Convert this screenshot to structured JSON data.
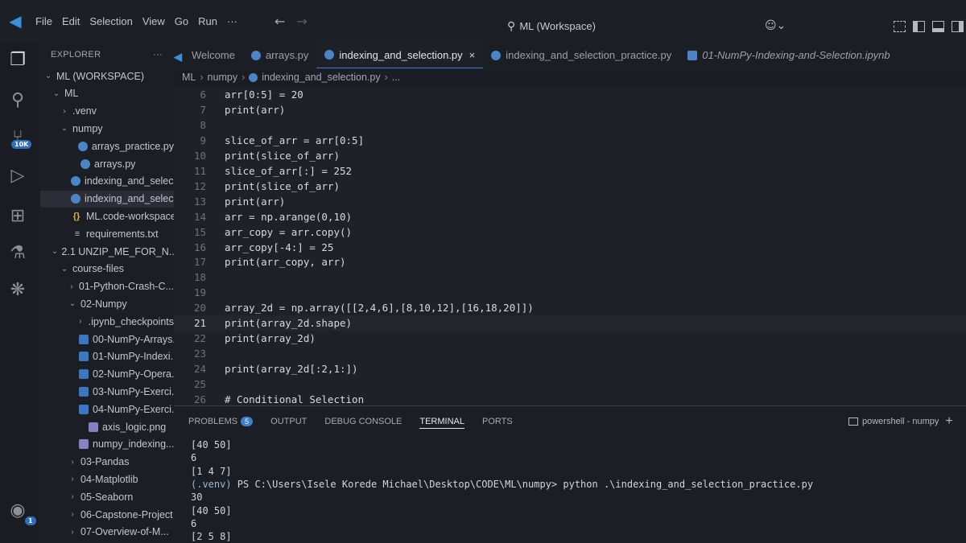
{
  "titlebar": {
    "menu": [
      "File",
      "Edit",
      "Selection",
      "View",
      "Go",
      "Run",
      "···"
    ],
    "search_title": "ML (Workspace)"
  },
  "activitybar": {
    "source_control_badge": "10K",
    "account_badge": "1"
  },
  "sidebar": {
    "title": "EXPLORER",
    "more": "···",
    "tree": [
      {
        "label": "ML (WORKSPACE)",
        "indent": 0,
        "chev": "v",
        "icon": "none"
      },
      {
        "label": "ML",
        "indent": 1,
        "chev": "v",
        "icon": "none"
      },
      {
        "label": ".venv",
        "indent": 2,
        "chev": ">",
        "icon": "none"
      },
      {
        "label": "numpy",
        "indent": 2,
        "chev": "v",
        "icon": "none"
      },
      {
        "label": "arrays_practice.py",
        "indent": 3,
        "chev": "",
        "icon": "py"
      },
      {
        "label": "arrays.py",
        "indent": 3,
        "chev": "",
        "icon": "py"
      },
      {
        "label": "indexing_and_selec...",
        "indent": 3,
        "chev": "",
        "icon": "py"
      },
      {
        "label": "indexing_and_selec...",
        "indent": 3,
        "chev": "",
        "icon": "py",
        "selected": true
      },
      {
        "label": "ML.code-workspace",
        "indent": 3,
        "chev": "",
        "icon": "cfg"
      },
      {
        "label": "requirements.txt",
        "indent": 2,
        "chev": "",
        "icon": "txt"
      },
      {
        "label": "2.1 UNZIP_ME_FOR_N...",
        "indent": 1,
        "chev": "v",
        "icon": "none"
      },
      {
        "label": "course-files",
        "indent": 2,
        "chev": "v",
        "icon": "none"
      },
      {
        "label": "01-Python-Crash-C...",
        "indent": 3,
        "chev": ">",
        "icon": "none"
      },
      {
        "label": "02-Numpy",
        "indent": 3,
        "chev": "v",
        "icon": "none"
      },
      {
        "label": ".ipynb_checkpoints",
        "indent": 4,
        "chev": ">",
        "icon": "none"
      },
      {
        "label": "00-NumPy-Arrays...",
        "indent": 4,
        "chev": "",
        "icon": "nb"
      },
      {
        "label": "01-NumPy-Indexi...",
        "indent": 4,
        "chev": "",
        "icon": "nb"
      },
      {
        "label": "02-NumPy-Opera...",
        "indent": 4,
        "chev": "",
        "icon": "nb"
      },
      {
        "label": "03-NumPy-Exerci...",
        "indent": 4,
        "chev": "",
        "icon": "nb"
      },
      {
        "label": "04-NumPy-Exerci...",
        "indent": 4,
        "chev": "",
        "icon": "nb"
      },
      {
        "label": "axis_logic.png",
        "indent": 4,
        "chev": "",
        "icon": "img"
      },
      {
        "label": "numpy_indexing....",
        "indent": 4,
        "chev": "",
        "icon": "img"
      },
      {
        "label": "03-Pandas",
        "indent": 3,
        "chev": ">",
        "icon": "none"
      },
      {
        "label": "04-Matplotlib",
        "indent": 3,
        "chev": ">",
        "icon": "none"
      },
      {
        "label": "05-Seaborn",
        "indent": 3,
        "chev": ">",
        "icon": "none"
      },
      {
        "label": "06-Capstone-Project",
        "indent": 3,
        "chev": ">",
        "icon": "none"
      },
      {
        "label": "07-Overview-of-M...",
        "indent": 3,
        "chev": ">",
        "icon": "none"
      }
    ]
  },
  "tabs": [
    {
      "label": "Welcome",
      "icon": "vsc",
      "active": false,
      "italic": false
    },
    {
      "label": "arrays.py",
      "icon": "py",
      "active": false,
      "italic": false
    },
    {
      "label": "indexing_and_selection.py",
      "icon": "py",
      "active": true,
      "italic": false,
      "close": "×"
    },
    {
      "label": "indexing_and_selection_practice.py",
      "icon": "py",
      "active": false,
      "italic": false
    },
    {
      "label": "01-NumPy-Indexing-and-Selection.ipynb",
      "icon": "nb",
      "active": false,
      "italic": true
    }
  ],
  "breadcrumb": [
    "ML",
    "numpy",
    "indexing_and_selection.py",
    "..."
  ],
  "editor": {
    "current_line": "21",
    "lines": [
      {
        "n": "6",
        "code": "arr[0:5] = 20"
      },
      {
        "n": "7",
        "code": "print(arr)"
      },
      {
        "n": "8",
        "code": ""
      },
      {
        "n": "9",
        "code": "slice_of_arr = arr[0:5]"
      },
      {
        "n": "10",
        "code": "print(slice_of_arr)"
      },
      {
        "n": "11",
        "code": "slice_of_arr[:] = 252"
      },
      {
        "n": "12",
        "code": "print(slice_of_arr)"
      },
      {
        "n": "13",
        "code": "print(arr)"
      },
      {
        "n": "14",
        "code": "arr = np.arange(0,10)"
      },
      {
        "n": "15",
        "code": "arr_copy = arr.copy()"
      },
      {
        "n": "16",
        "code": "arr_copy[-4:] = 25"
      },
      {
        "n": "17",
        "code": "print(arr_copy, arr)"
      },
      {
        "n": "18",
        "code": ""
      },
      {
        "n": "19",
        "code": ""
      },
      {
        "n": "20",
        "code": "array_2d = np.array([[2,4,6],[8,10,12],[16,18,20]])"
      },
      {
        "n": "21",
        "code": "print(array_2d.shape)"
      },
      {
        "n": "22",
        "code": "print(array_2d)"
      },
      {
        "n": "23",
        "code": ""
      },
      {
        "n": "24",
        "code": "print(array_2d[:2,1:])"
      },
      {
        "n": "25",
        "code": ""
      },
      {
        "n": "26",
        "code": "# Conditional Selection"
      }
    ]
  },
  "panel": {
    "tabs": [
      "PROBLEMS",
      "OUTPUT",
      "DEBUG CONSOLE",
      "TERMINAL",
      "PORTS"
    ],
    "active_tab": "TERMINAL",
    "problems_count": "5",
    "terminal_name": "powershell - numpy",
    "add": "+",
    "output": [
      {
        "venv": "",
        "text": "[40 50]"
      },
      {
        "venv": "",
        "text": "6"
      },
      {
        "venv": "",
        "text": "[1 4 7]"
      },
      {
        "venv": "(.venv)",
        "text": " PS C:\\Users\\Isele Korede Michael\\Desktop\\CODE\\ML\\numpy> python .\\indexing_and_selection_practice.py"
      },
      {
        "venv": "",
        "text": "30"
      },
      {
        "venv": "",
        "text": "[40 50]"
      },
      {
        "venv": "",
        "text": "6"
      },
      {
        "venv": "",
        "text": "[2 5 8]"
      }
    ]
  }
}
